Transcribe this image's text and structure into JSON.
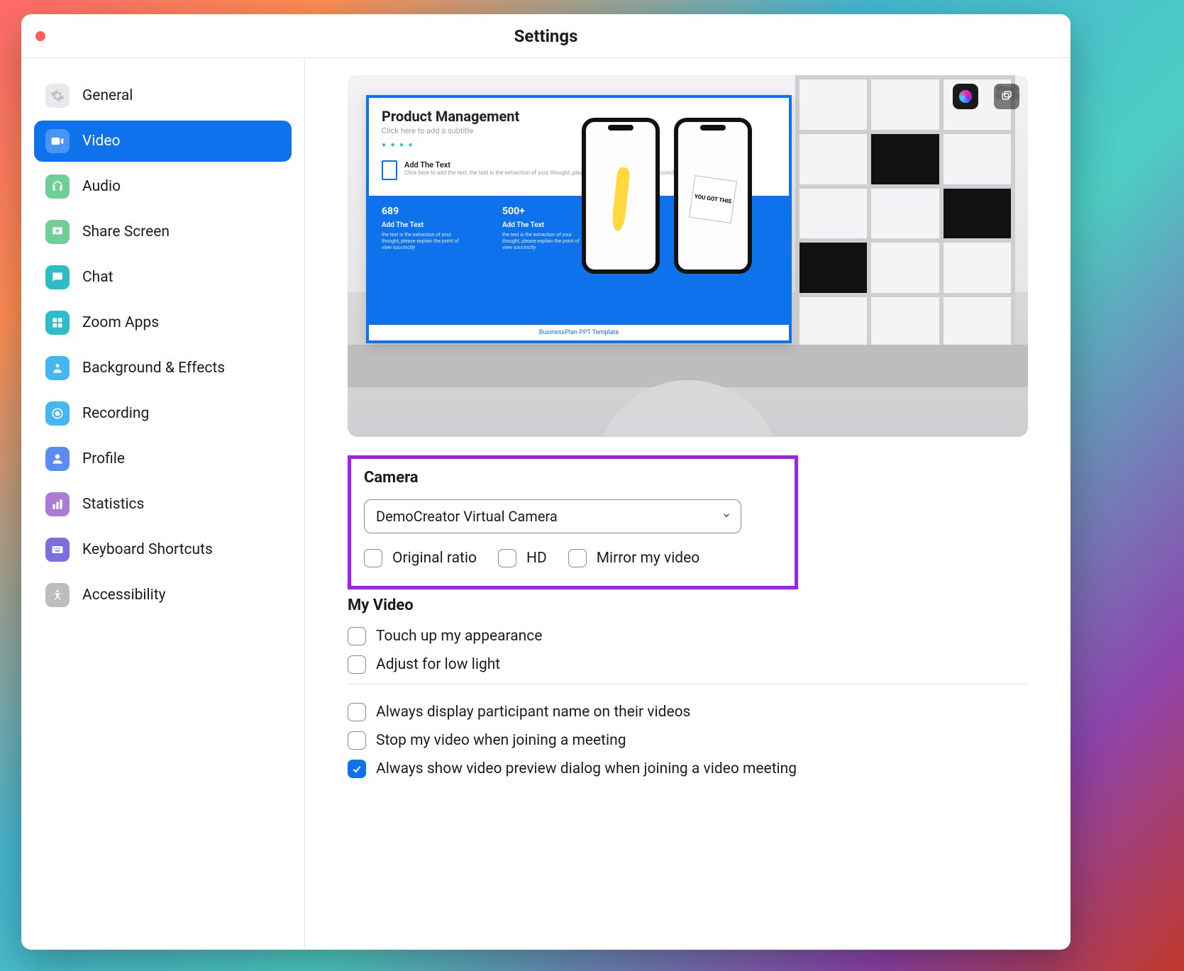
{
  "window": {
    "title": "Settings"
  },
  "sidebar": {
    "items": [
      {
        "id": "general",
        "label": "General",
        "icon_bg": "#e9e9eb",
        "icon_fg": "#bdbdbf"
      },
      {
        "id": "video",
        "label": "Video",
        "icon_bg": "#ffffff",
        "icon_fg": "#ffffff",
        "active": true
      },
      {
        "id": "audio",
        "label": "Audio",
        "icon_bg": "#6fcf97",
        "icon_fg": "#ffffff"
      },
      {
        "id": "share-screen",
        "label": "Share Screen",
        "icon_bg": "#6fcf97",
        "icon_fg": "#ffffff"
      },
      {
        "id": "chat",
        "label": "Chat",
        "icon_bg": "#2bbec7",
        "icon_fg": "#ffffff"
      },
      {
        "id": "zoom-apps",
        "label": "Zoom Apps",
        "icon_bg": "#2bbec7",
        "icon_fg": "#ffffff"
      },
      {
        "id": "background-effects",
        "label": "Background & Effects",
        "icon_bg": "#45b7f0",
        "icon_fg": "#ffffff"
      },
      {
        "id": "recording",
        "label": "Recording",
        "icon_bg": "#45b7f0",
        "icon_fg": "#ffffff"
      },
      {
        "id": "profile",
        "label": "Profile",
        "icon_bg": "#5b8def",
        "icon_fg": "#ffffff"
      },
      {
        "id": "statistics",
        "label": "Statistics",
        "icon_bg": "#a97bd6",
        "icon_fg": "#ffffff"
      },
      {
        "id": "keyboard-shortcuts",
        "label": "Keyboard Shortcuts",
        "icon_bg": "#7b6fe0",
        "icon_fg": "#ffffff"
      },
      {
        "id": "accessibility",
        "label": "Accessibility",
        "icon_bg": "#bdbdbf",
        "icon_fg": "#ffffff"
      }
    ]
  },
  "preview": {
    "slide_title": "Product Management",
    "slide_subtitle": "Click here to add a subtitle",
    "mid_heading": "Add The Text",
    "mid_desc": "Click here to add the text, the text is the extraction of your thought, please explain the point of view succinctly",
    "band": [
      {
        "num": "689",
        "label": "Add The Text",
        "desc": "the text is the extraction of your thought, please explain the point of view succinctly"
      },
      {
        "num": "500+",
        "label": "Add The Text",
        "desc": "the text is the extraction of your thought, please explain the point of view succinctly"
      }
    ],
    "footer": "BusinessPlan PPT Template",
    "phone_note": "YOU GOT THIS",
    "brand_text": "Wonde\nDemoC"
  },
  "camera": {
    "section_title": "Camera",
    "selected": "DemoCreator Virtual Camera",
    "options": [
      {
        "id": "original-ratio",
        "label": "Original ratio",
        "checked": false
      },
      {
        "id": "hd",
        "label": "HD",
        "checked": false
      },
      {
        "id": "mirror",
        "label": "Mirror my video",
        "checked": false
      }
    ]
  },
  "my_video": {
    "section_title": "My Video",
    "options": [
      {
        "id": "touch-up",
        "label": "Touch up my appearance",
        "checked": false
      },
      {
        "id": "low-light",
        "label": "Adjust for low light",
        "checked": false
      }
    ]
  },
  "more_options": [
    {
      "id": "display-name",
      "label": "Always display participant name on their videos",
      "checked": false
    },
    {
      "id": "stop-video-join",
      "label": "Stop my video when joining a meeting",
      "checked": false
    },
    {
      "id": "preview-dialog",
      "label": "Always show video preview dialog when joining a video meeting",
      "checked": true
    }
  ]
}
